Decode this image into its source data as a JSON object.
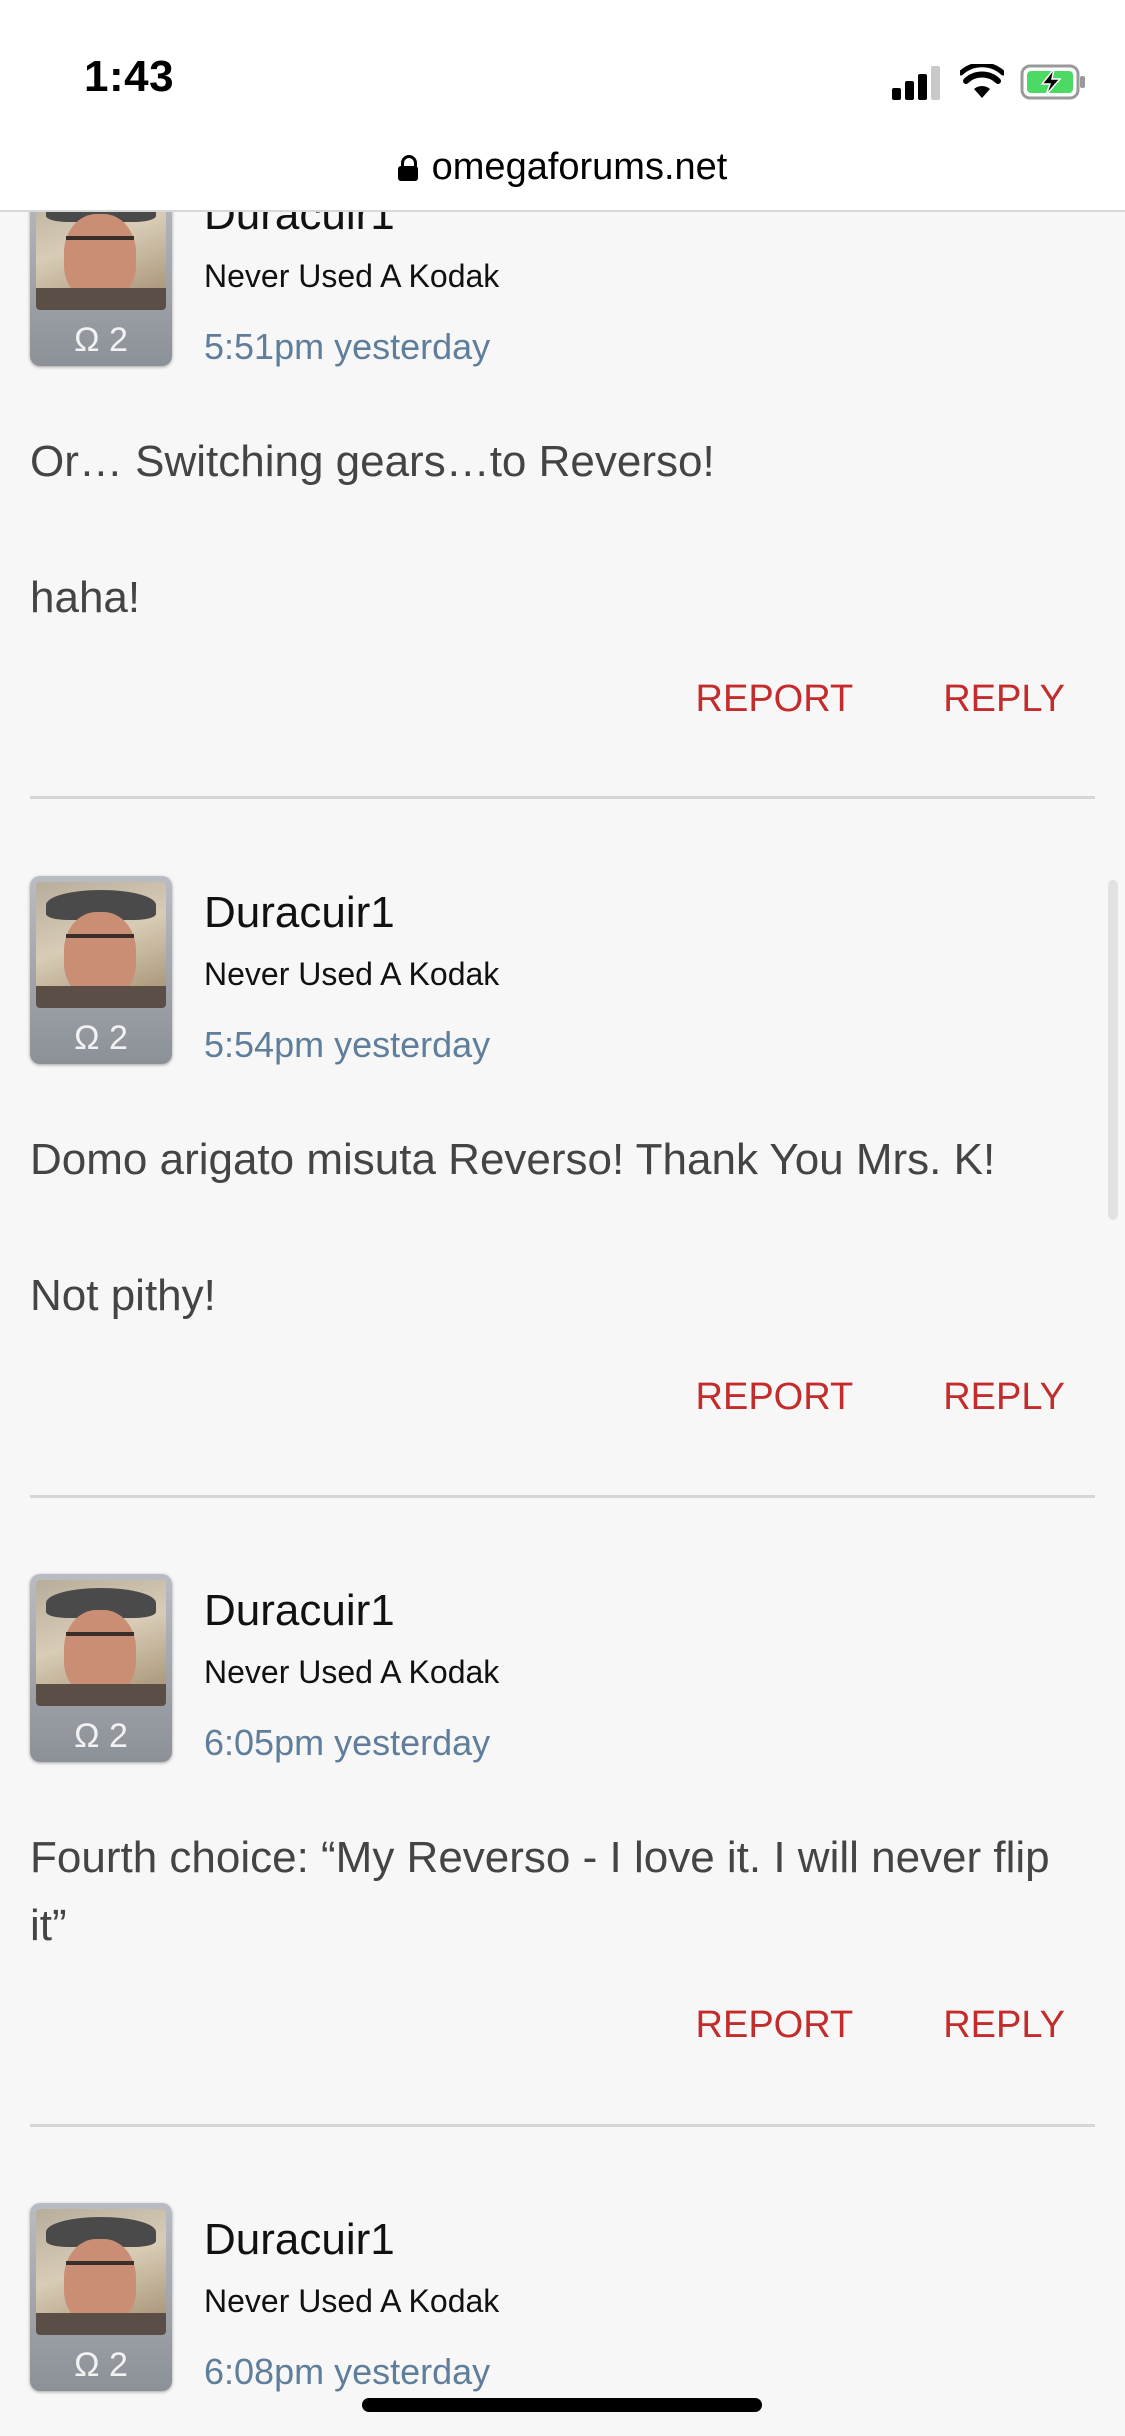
{
  "status_bar": {
    "time": "1:43",
    "icons": [
      "cellular-signal-icon",
      "wifi-icon",
      "battery-charging-icon"
    ],
    "battery_color": "#4cd964"
  },
  "url_bar": {
    "domain": "omegaforums.net",
    "icon": "lock-icon"
  },
  "colors": {
    "action": "#c42b2b",
    "timestamp": "#5f7e9b",
    "background": "#f7f7f7"
  },
  "posts": [
    {
      "username": "Duracuir1",
      "user_title": "Never Used A Kodak",
      "rank": "Ω 2",
      "time": "5:51pm yesterday",
      "content": [
        "Or… Switching gears…to Reverso!",
        "",
        "haha!"
      ],
      "report": "REPORT",
      "reply": "REPLY"
    },
    {
      "username": "Duracuir1",
      "user_title": "Never Used A Kodak",
      "rank": "Ω 2",
      "time": "5:54pm yesterday",
      "content": [
        "Domo arigato misuta Reverso! Thank You Mrs. K!",
        "",
        "Not pithy!"
      ],
      "report": "REPORT",
      "reply": "REPLY"
    },
    {
      "username": "Duracuir1",
      "user_title": "Never Used A Kodak",
      "rank": "Ω 2",
      "time": "6:05pm yesterday",
      "content": [
        "Fourth choice: “My Reverso - I love it. I will never flip it”"
      ],
      "report": "REPORT",
      "reply": "REPLY"
    },
    {
      "username": "Duracuir1",
      "user_title": "Never Used A Kodak",
      "rank": "Ω 2",
      "time": "6:08pm yesterday"
    }
  ]
}
